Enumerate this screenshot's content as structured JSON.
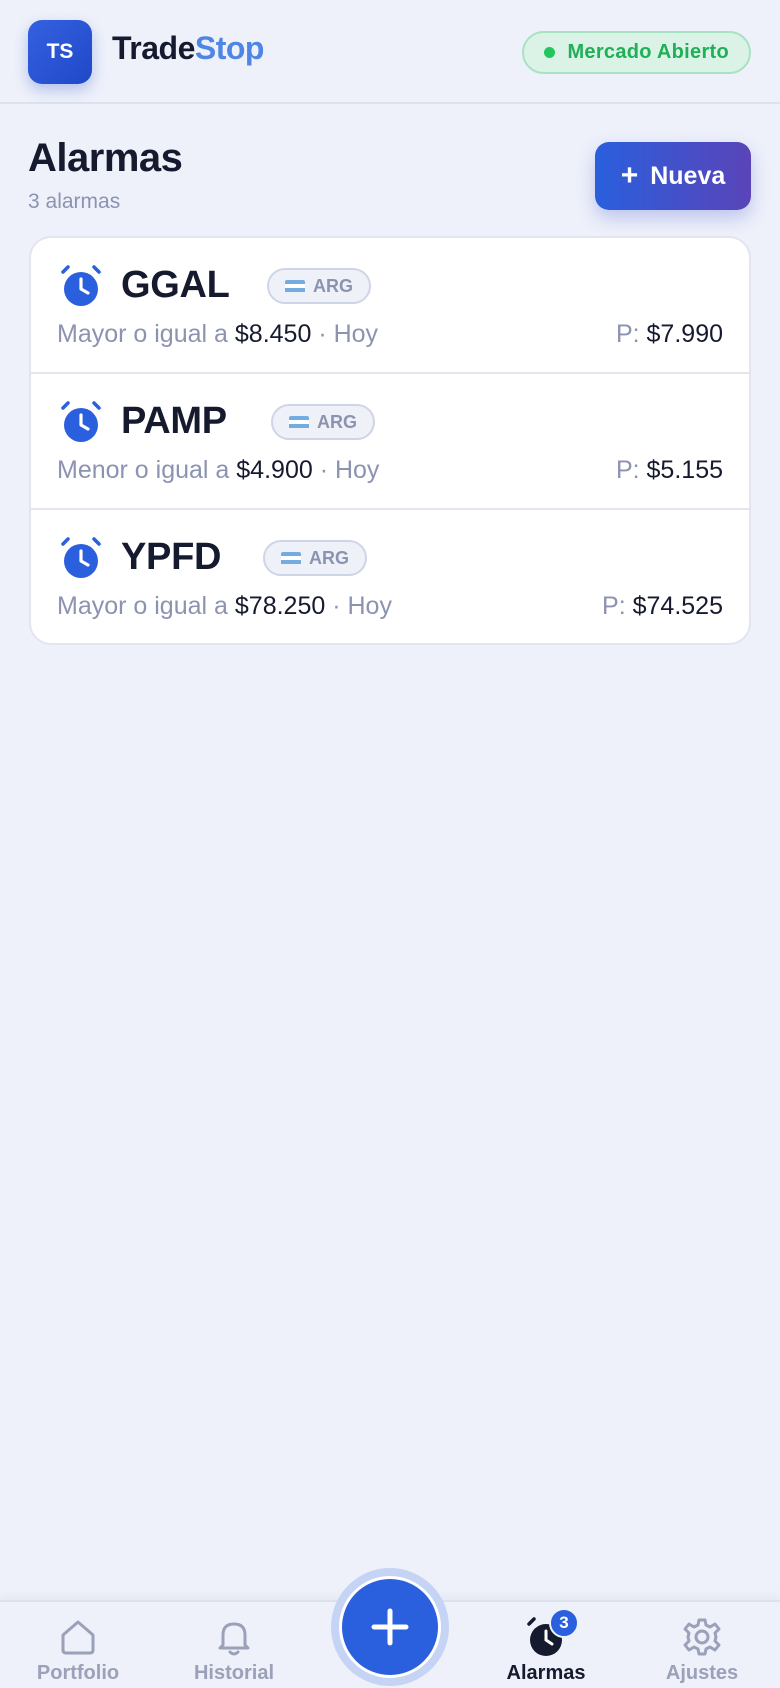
{
  "header": {
    "logo_text": "TS",
    "brand_part1": "Trade",
    "brand_part2": "Stop",
    "market_status": "Mercado Abierto"
  },
  "page": {
    "title": "Alarmas",
    "subtitle": "3 alarmas",
    "new_button_plus": "+",
    "new_button_label": "Nueva"
  },
  "alarms": [
    {
      "ticker": "GGAL",
      "market": "ARG",
      "condition": "Mayor o igual a",
      "target": "$8.450",
      "when": "· Hoy",
      "current_label": "P:",
      "current": "$7.990"
    },
    {
      "ticker": "PAMP",
      "market": "ARG",
      "condition": "Menor o igual a",
      "target": "$4.900",
      "when": "· Hoy",
      "current_label": "P:",
      "current": "$5.155"
    },
    {
      "ticker": "YPFD",
      "market": "ARG",
      "condition": "Mayor o igual a",
      "target": "$78.250",
      "when": "· Hoy",
      "current_label": "P:",
      "current": "$74.525"
    }
  ],
  "nav": {
    "items": [
      {
        "label": "Portfolio",
        "icon": "home-icon"
      },
      {
        "label": "Historial",
        "icon": "bell-icon"
      },
      {
        "label": "Alarmas",
        "icon": "alarm-clock-icon",
        "badge": "3",
        "active": true
      },
      {
        "label": "Ajustes",
        "icon": "gear-icon"
      }
    ],
    "fab_icon": "plus-icon"
  },
  "colors": {
    "accent": "#2a5fdd",
    "market_open": "#1fb057",
    "background": "#eef1fa"
  }
}
